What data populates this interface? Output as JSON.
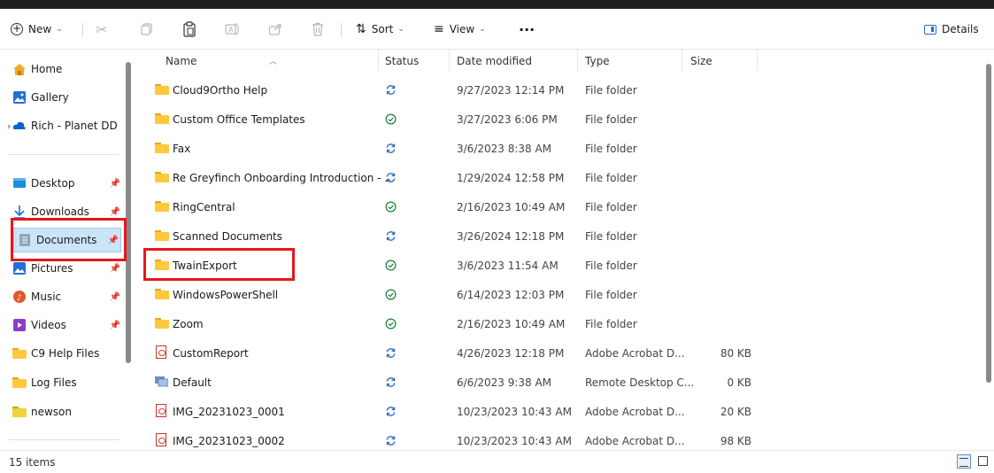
{
  "toolbar": {
    "new_label": "New",
    "sort_label": "Sort",
    "view_label": "View",
    "more_label": "···",
    "details_label": "Details"
  },
  "nav": {
    "items": [
      {
        "label": "Home",
        "icon": "home-icon"
      },
      {
        "label": "Gallery",
        "icon": "gallery-icon"
      },
      {
        "label": "Rich - Planet DD",
        "icon": "cloud-icon"
      },
      {
        "label": "Desktop",
        "icon": "desktop-icon",
        "pinned": true
      },
      {
        "label": "Downloads",
        "icon": "download-icon",
        "pinned": true
      },
      {
        "label": "Documents",
        "icon": "documents-icon",
        "pinned": true,
        "selected": true
      },
      {
        "label": "Pictures",
        "icon": "pictures-icon",
        "pinned": true
      },
      {
        "label": "Music",
        "icon": "music-icon",
        "pinned": true
      },
      {
        "label": "Videos",
        "icon": "videos-icon",
        "pinned": true
      },
      {
        "label": "C9 Help Files",
        "icon": "folder-icon"
      },
      {
        "label": "Log Files",
        "icon": "folder-icon"
      },
      {
        "label": "newson",
        "icon": "folder-icon"
      }
    ]
  },
  "columns": {
    "name": "Name",
    "status": "Status",
    "date": "Date modified",
    "type": "Type",
    "size": "Size"
  },
  "files": [
    {
      "name": "Cloud9Ortho Help",
      "status": "sync",
      "date": "9/27/2023 12:14 PM",
      "type": "File folder",
      "size": "",
      "icon": "folder"
    },
    {
      "name": "Custom Office Templates",
      "status": "available",
      "date": "3/27/2023 6:06 PM",
      "type": "File folder",
      "size": "",
      "icon": "folder"
    },
    {
      "name": "Fax",
      "status": "sync",
      "date": "3/6/2023 8:38 AM",
      "type": "File folder",
      "size": "",
      "icon": "folder"
    },
    {
      "name": "Re Greyfinch Onboarding Introduction - ...",
      "status": "sync",
      "date": "1/29/2024 12:58 PM",
      "type": "File folder",
      "size": "",
      "icon": "folder"
    },
    {
      "name": "RingCentral",
      "status": "available",
      "date": "2/16/2023 10:49 AM",
      "type": "File folder",
      "size": "",
      "icon": "folder"
    },
    {
      "name": "Scanned Documents",
      "status": "sync",
      "date": "3/26/2024 12:18 PM",
      "type": "File folder",
      "size": "",
      "icon": "folder"
    },
    {
      "name": "TwainExport",
      "status": "available",
      "date": "3/6/2023 11:54 AM",
      "type": "File folder",
      "size": "",
      "icon": "folder"
    },
    {
      "name": "WindowsPowerShell",
      "status": "available",
      "date": "6/14/2023 12:03 PM",
      "type": "File folder",
      "size": "",
      "icon": "folder"
    },
    {
      "name": "Zoom",
      "status": "available",
      "date": "2/16/2023 10:49 AM",
      "type": "File folder",
      "size": "",
      "icon": "folder"
    },
    {
      "name": "CustomReport",
      "status": "sync",
      "date": "4/26/2023 12:18 PM",
      "type": "Adobe Acrobat D...",
      "size": "80 KB",
      "icon": "pdf"
    },
    {
      "name": "Default",
      "status": "sync",
      "date": "6/6/2023 9:38 AM",
      "type": "Remote Desktop C...",
      "size": "0 KB",
      "icon": "rdp"
    },
    {
      "name": "IMG_20231023_0001",
      "status": "sync",
      "date": "10/23/2023 10:43 AM",
      "type": "Adobe Acrobat D...",
      "size": "20 KB",
      "icon": "pdf"
    },
    {
      "name": "IMG_20231023_0002",
      "status": "sync",
      "date": "10/23/2023 10:43 AM",
      "type": "Adobe Acrobat D...",
      "size": "98 KB",
      "icon": "pdf"
    }
  ],
  "statusbar": {
    "item_count": "15 items"
  },
  "colors": {
    "accent": "#0067c0",
    "selection": "#cce4f7",
    "highlight": "#e8161b",
    "sync_icon": "#2a6cc4",
    "available_icon": "#188038",
    "folder": "#ffc83d"
  }
}
